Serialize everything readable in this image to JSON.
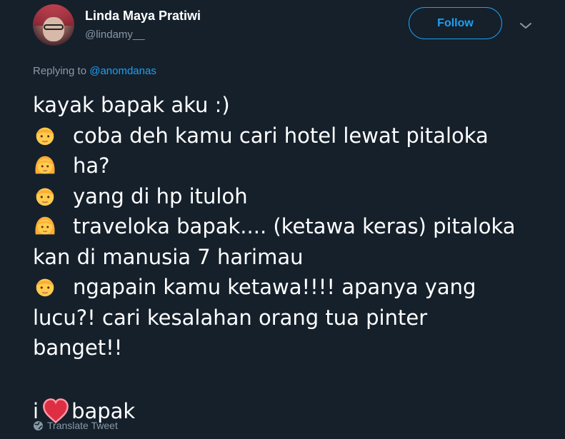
{
  "author": {
    "name": "Linda Maya Pratiwi",
    "handle": "@lindamy__"
  },
  "follow_label": "Follow",
  "reply": {
    "prefix": "Replying to",
    "mention": "@anomdanas"
  },
  "tweet": {
    "line1": "kayak bapak aku :)",
    "line2": "coba deh kamu cari hotel lewat pitaloka",
    "line3": "ha?",
    "line4": "yang di hp ituloh",
    "line5": "traveloka bapak.... (ketawa keras) pitaloka",
    "line6": "kan di manusia 7 harimau",
    "line7": "ngapain kamu ketawa!!!! apanya yang",
    "line8": "lucu?! cari kesalahan orang tua pinter",
    "line9": "banget!!",
    "love_prefix": "i",
    "love_suffix": "bapak"
  },
  "translate_label": "Translate Tweet",
  "icons": {
    "man": "man-emoji-icon",
    "woman": "woman-emoji-icon",
    "heart": "heart-emoji-icon",
    "globe": "globe-icon",
    "chevron": "chevron-down-icon"
  },
  "colors": {
    "background": "#15202b",
    "accent": "#1da1f2",
    "secondary_text": "#8899a6",
    "emoji_skin": "#ffcc4d",
    "emoji_hair": "#ffac33"
  }
}
